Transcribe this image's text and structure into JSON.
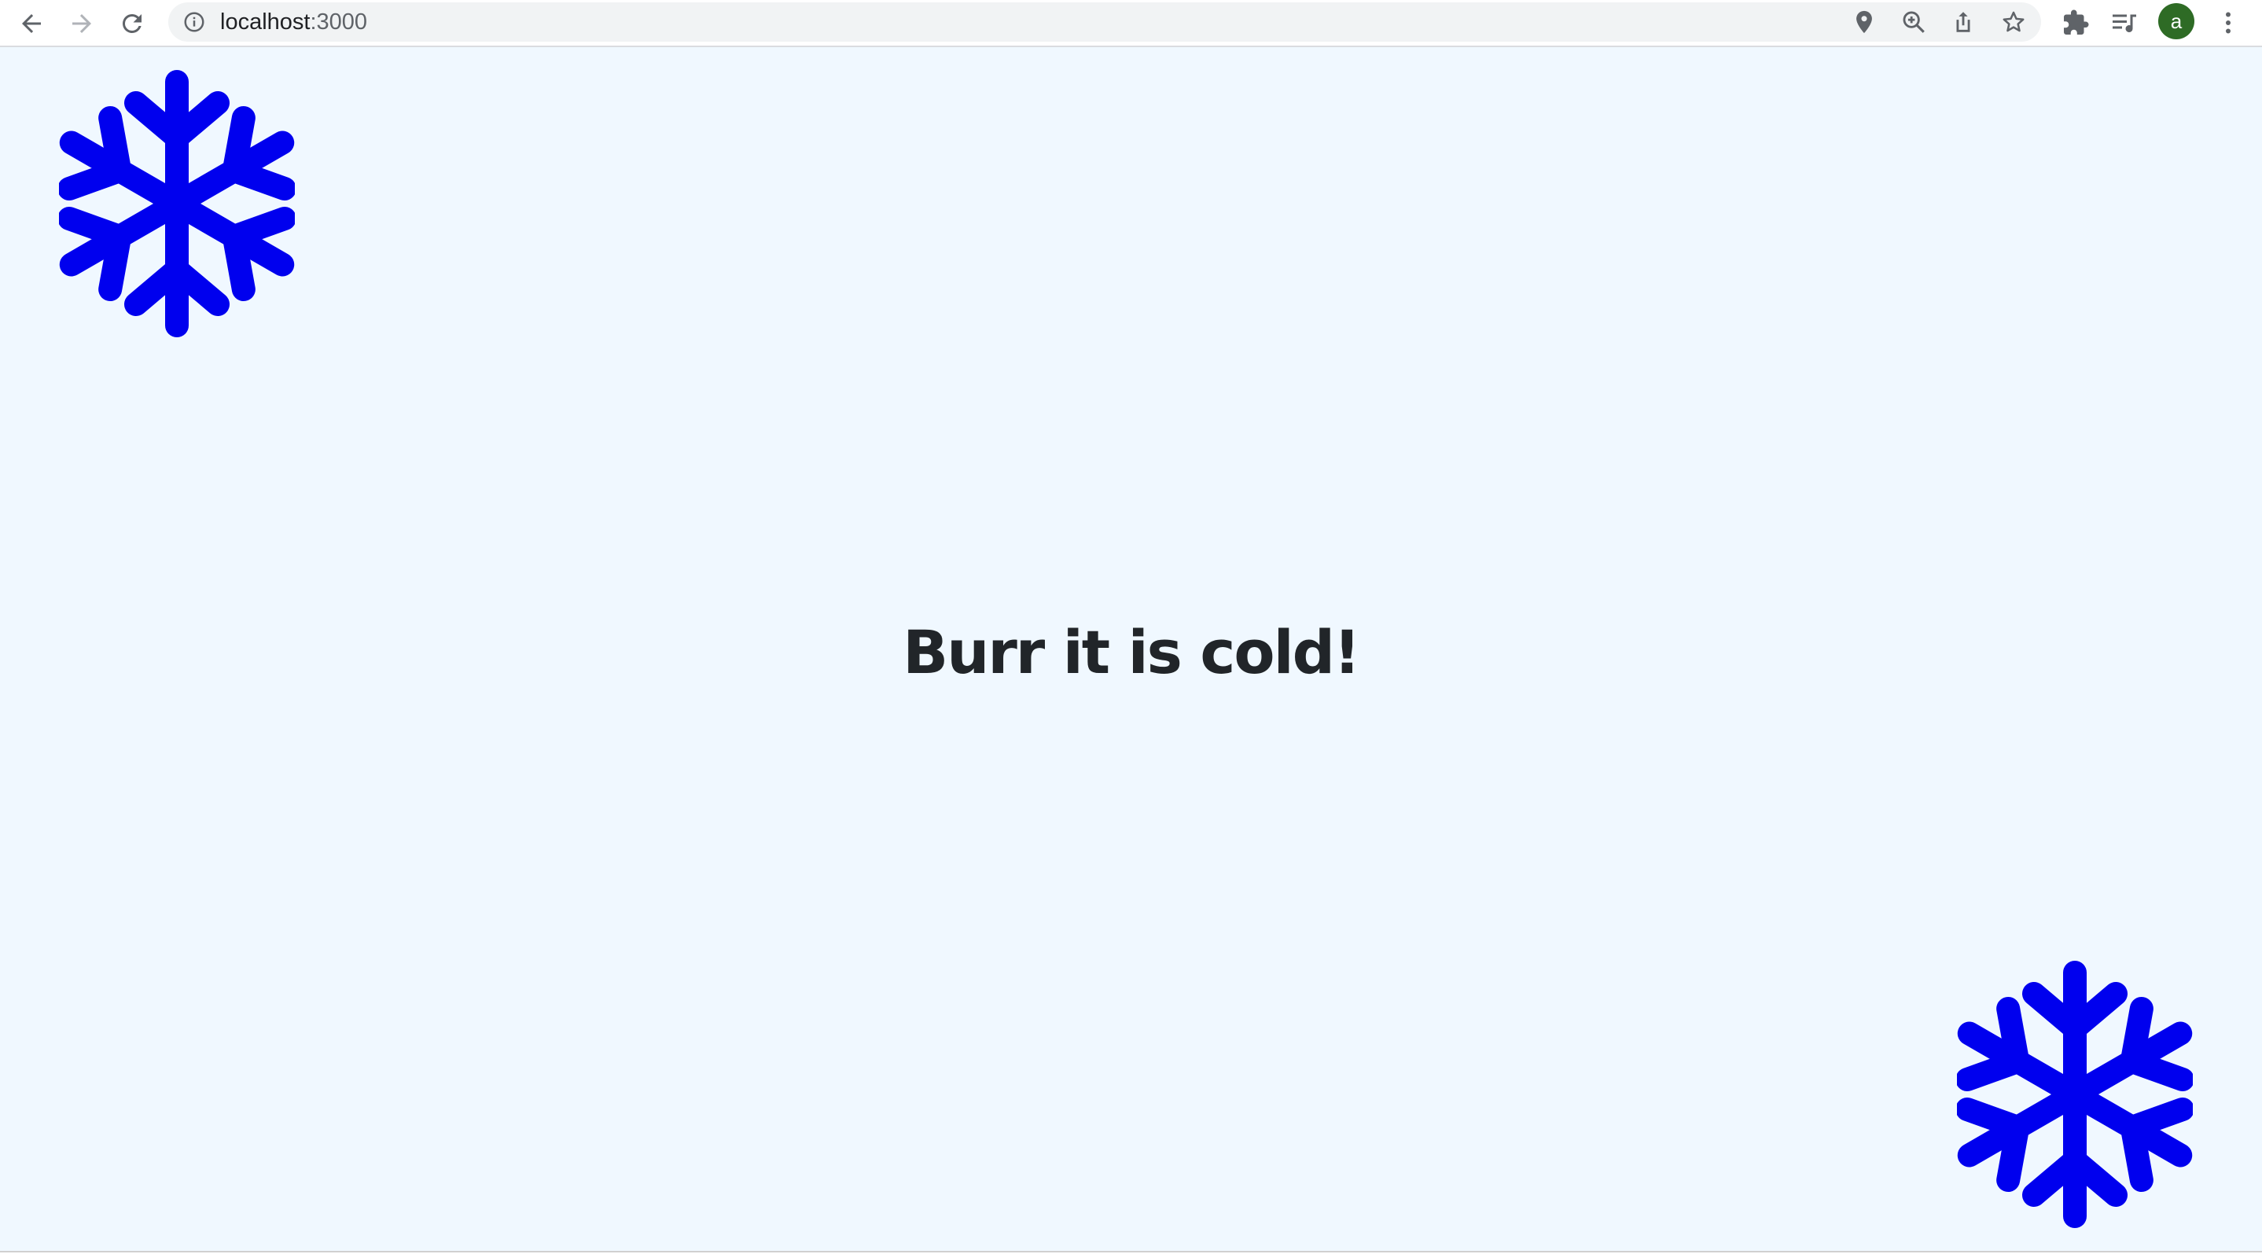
{
  "browser": {
    "url_host": "localhost",
    "url_port": ":3000",
    "avatar_letter": "a",
    "icons": [
      "back-icon",
      "forward-icon",
      "reload-icon",
      "info-icon",
      "location-icon",
      "zoom-icon",
      "share-icon",
      "star-icon",
      "extensions-icon",
      "reading-list-icon",
      "menu-icon"
    ]
  },
  "page": {
    "heading": "Burr it is cold!",
    "background_color": "#f0f8ff",
    "snowflake_color": "#0000ee"
  }
}
